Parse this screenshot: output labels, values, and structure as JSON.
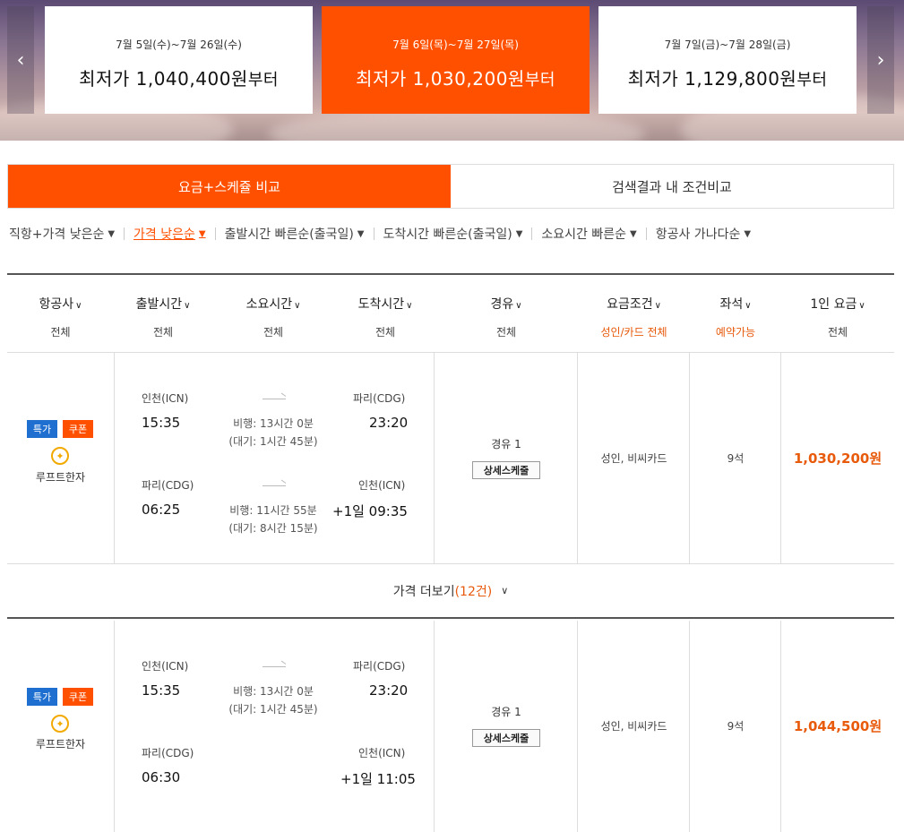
{
  "banner": {
    "prev_icon": "chevron-left-icon",
    "next_icon": "chevron-right-icon",
    "cards": [
      {
        "dates": "7월 5일(수)~7월 26일(수)",
        "label": "최저가",
        "price": "1,040,400원",
        "suffix": "부터",
        "active": false
      },
      {
        "dates": "7월 6일(목)~7월 27일(목)",
        "label": "최저가",
        "price": "1,030,200원",
        "suffix": "부터",
        "active": true
      },
      {
        "dates": "7월 7일(금)~7월 28일(금)",
        "label": "최저가",
        "price": "1,129,800원",
        "suffix": "부터",
        "active": false
      }
    ]
  },
  "tabs": [
    "요금+스케쥴 비교",
    "검색결과 내 조건비교"
  ],
  "sort": [
    "직항+가격 낮은순",
    "가격 낮은순",
    "출발시간 빠른순(출국일)",
    "도착시간 빠른순(출국일)",
    "소요시간 빠른순",
    "항공사 가나다순"
  ],
  "table_header": [
    {
      "title": "항공사",
      "sub": "전체"
    },
    {
      "title": "출발시간",
      "sub": "전체"
    },
    {
      "title": "소요시간",
      "sub": "전체"
    },
    {
      "title": "도착시간",
      "sub": "전체"
    },
    {
      "title": "경유",
      "sub": "전체"
    },
    {
      "title": "요금조건",
      "sub": "성인/카드 전체"
    },
    {
      "title": "좌석",
      "sub": "예약가능"
    },
    {
      "title": "1인 요금",
      "sub": "전체"
    }
  ],
  "results": [
    {
      "badges": [
        "특가",
        "쿠폰"
      ],
      "airline": "루프트한자",
      "outbound": {
        "from": "인천(ICN)",
        "dep": "15:35",
        "flight": "비행: 13시간 0분",
        "wait": "(대기: 1시간 45분)",
        "to": "파리(CDG)",
        "arr": "23:20"
      },
      "inbound": {
        "from": "파리(CDG)",
        "dep": "06:25",
        "flight": "비행: 11시간 55분",
        "wait": "(대기: 8시간 15분)",
        "to": "인천(ICN)",
        "arr": "+1일 09:35"
      },
      "via": "경유 1",
      "detail": "상세스케줄",
      "condition": "성인, 비씨카드",
      "seats": "9석",
      "price": "1,030,200원"
    },
    {
      "badges": [
        "특가",
        "쿠폰"
      ],
      "airline": "루프트한자",
      "outbound": {
        "from": "인천(ICN)",
        "dep": "15:35",
        "flight": "비행: 13시간 0분",
        "wait": "(대기: 1시간 45분)",
        "to": "파리(CDG)",
        "arr": "23:20"
      },
      "inbound": {
        "from": "파리(CDG)",
        "dep": "06:30",
        "to": "인천(ICN)",
        "arr": "+1일 11:05"
      },
      "via": "경유 1",
      "detail": "상세스케줄",
      "condition": "성인, 비씨카드",
      "seats": "9석",
      "price": "1,044,500원"
    }
  ],
  "more": {
    "label": "가격 더보기",
    "count": "(12건)"
  },
  "colors": {
    "accent": "#ff5000",
    "price": "#e85a0c",
    "badge_blue": "#1e6fd0"
  }
}
